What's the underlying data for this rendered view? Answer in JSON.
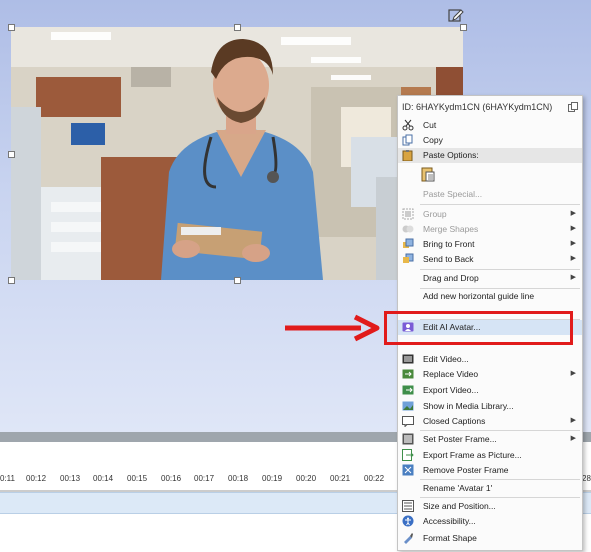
{
  "context_menu": {
    "header": "ID: 6HAYKydm1CN  (6HAYKydm1CN)",
    "items": [
      {
        "label": "Cut",
        "icon": "scissors-icon"
      },
      {
        "label": "Copy",
        "icon": "copy-icon"
      },
      {
        "label": "Paste Options:",
        "icon": "paste-icon"
      },
      {
        "label": "Paste Special...",
        "icon": ""
      },
      {
        "label": "Group",
        "icon": "group-icon"
      },
      {
        "label": "Merge Shapes",
        "icon": "merge-shapes-icon"
      },
      {
        "label": "Bring to Front",
        "icon": "bring-to-front-icon"
      },
      {
        "label": "Send to Back",
        "icon": "send-to-back-icon"
      },
      {
        "label": "Drag and Drop",
        "icon": ""
      },
      {
        "label": "Add new horizontal guide line",
        "icon": ""
      },
      {
        "label": "Edit AI Avatar...",
        "icon": "ai-avatar-icon"
      },
      {
        "label": "Edit Video...",
        "icon": "edit-video-icon"
      },
      {
        "label": "Replace Video",
        "icon": "replace-video-icon"
      },
      {
        "label": "Export Video...",
        "icon": "export-video-icon"
      },
      {
        "label": "Show in Media Library...",
        "icon": "media-library-icon"
      },
      {
        "label": "Closed Captions",
        "icon": "closed-captions-icon"
      },
      {
        "label": "Set Poster Frame...",
        "icon": "poster-frame-icon"
      },
      {
        "label": "Export Frame as Picture...",
        "icon": "export-frame-icon"
      },
      {
        "label": "Remove Poster Frame",
        "icon": "remove-poster-icon"
      },
      {
        "label": "Rename 'Avatar 1'",
        "icon": ""
      },
      {
        "label": "Size and Position...",
        "icon": "size-position-icon"
      },
      {
        "label": "Accessibility...",
        "icon": "accessibility-icon"
      },
      {
        "label": "Format Shape",
        "icon": "format-shape-icon"
      }
    ]
  },
  "timeline": {
    "ticks": [
      "0:11",
      "00:12",
      "00:13",
      "00:14",
      "00:15",
      "00:16",
      "00:17",
      "00:18",
      "00:19",
      "00:20",
      "00:21",
      "00:22",
      "28"
    ]
  },
  "colors": {
    "highlight_box": "#e11b1b",
    "menu_hover": "#d6e4f5",
    "track": "#dce9f7"
  }
}
